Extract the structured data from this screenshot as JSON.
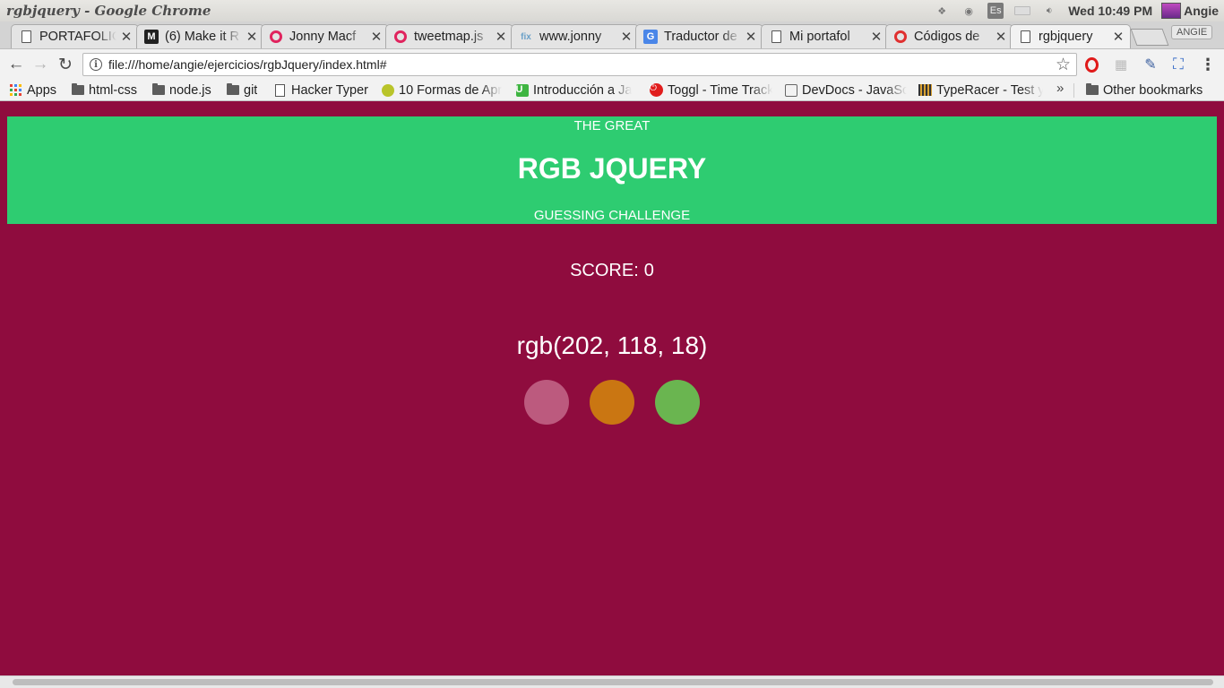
{
  "os": {
    "window_title": "rgbjquery - Google Chrome",
    "keyboard_layout": "Es",
    "clock": "Wed 10:49 PM",
    "user": "Angie"
  },
  "tabs": [
    {
      "label": "PORTAFOLIO",
      "icon": "document-icon"
    },
    {
      "label": "(6) Make it R",
      "icon": "medium-icon"
    },
    {
      "label": "Jonny Macf",
      "icon": "dribbble-icon"
    },
    {
      "label": "tweetmap.js",
      "icon": "dribbble-icon"
    },
    {
      "label": "www.jonny",
      "icon": "fix-icon"
    },
    {
      "label": "Traductor de",
      "icon": "google-translate-icon"
    },
    {
      "label": "Mi portafol",
      "icon": "document-icon"
    },
    {
      "label": "Códigos de",
      "icon": "opera-icon"
    },
    {
      "label": "rgbjquery",
      "icon": "document-icon",
      "active": true
    }
  ],
  "profile_badge": "ANGIE",
  "toolbar": {
    "url": "file:///home/angie/ejercicios/rgbJquery/index.html#"
  },
  "bookmarks": {
    "items": [
      {
        "label": "Apps",
        "icon": "apps-icon"
      },
      {
        "label": "html-css",
        "icon": "folder-icon"
      },
      {
        "label": "node.js",
        "icon": "folder-icon"
      },
      {
        "label": "git",
        "icon": "folder-icon"
      },
      {
        "label": "Hacker Typer",
        "icon": "document-icon"
      },
      {
        "label": "10 Formas de Apr",
        "icon": "lime-icon"
      },
      {
        "label": "Introducción a Ja",
        "icon": "udacity-icon"
      },
      {
        "label": "Toggl - Time Track",
        "icon": "toggl-icon"
      },
      {
        "label": "DevDocs - JavaSc",
        "icon": "devdocs-icon"
      },
      {
        "label": "TypeRacer - Test y",
        "icon": "typeracer-icon"
      }
    ],
    "more": "»",
    "other": "Other bookmarks"
  },
  "game": {
    "header_top": "THE GREAT",
    "title": "RGB JQUERY",
    "header_bottom": "GUESSING CHALLENGE",
    "score_label": "SCORE:",
    "score_value": "0",
    "target_color_text": "rgb(202, 118, 18)",
    "options": [
      {
        "color": "#bc5a7e"
      },
      {
        "color": "#ca7612"
      },
      {
        "color": "#6ab550"
      }
    ],
    "background_color": "#8f0c3e",
    "header_color": "#2ecc71"
  }
}
